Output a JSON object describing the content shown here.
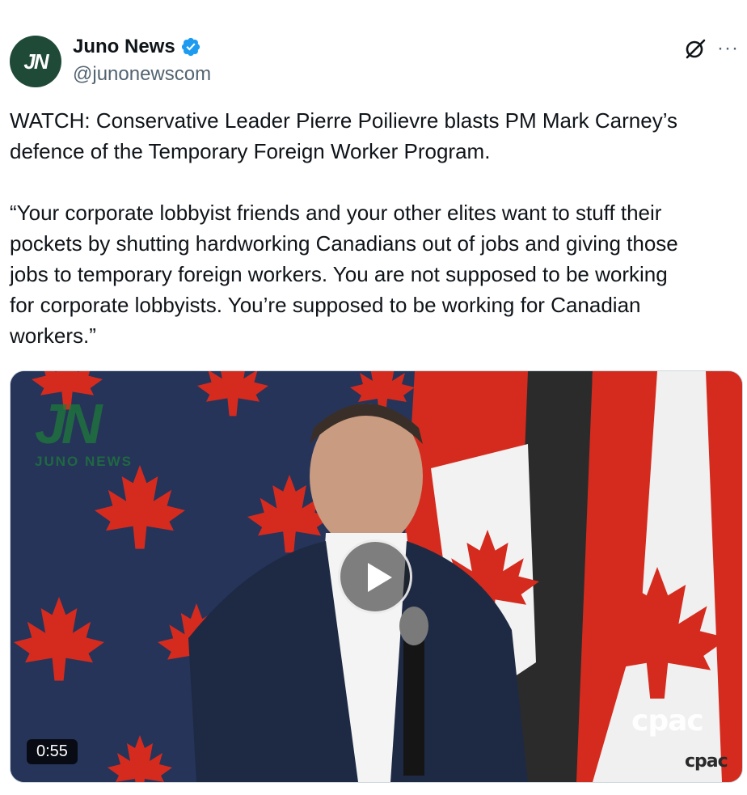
{
  "author": {
    "display_name": "Juno News",
    "handle": "@junonewscom",
    "avatar_text": "JN",
    "verified": true
  },
  "header_icons": {
    "grok": "grok-icon",
    "more": "more-icon",
    "more_glyph": "···"
  },
  "tweet": {
    "text": "WATCH: Conservative Leader Pierre Poilievre blasts PM Mark Carney’s\ndefence of the Temporary Foreign Worker Program.\n\n“Your corporate lobbyist friends and your other elites want to stuff their\npockets by shutting hardworking Canadians out of jobs and giving those\njobs to temporary foreign workers. You are not supposed to be working\nfor corporate lobbyists. You’re supposed to be working for Canadian\nworkers.”"
  },
  "media": {
    "type": "video",
    "duration": "0:55",
    "watermark_mark": "JN",
    "watermark_text": "JUNO NEWS",
    "broadcaster_logo": "cpac",
    "broadcaster_logo_small": "cpac"
  },
  "colors": {
    "avatar_bg": "#1f4a38",
    "verified_blue": "#1d9bf0",
    "text_primary": "#0f1419",
    "text_secondary": "#536471",
    "flag_red": "#d52b1e"
  }
}
